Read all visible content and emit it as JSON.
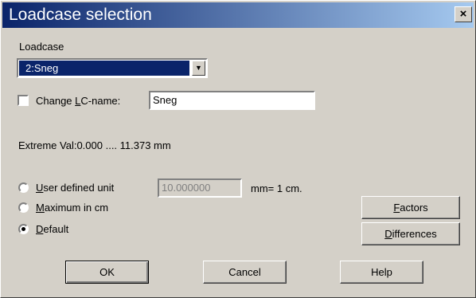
{
  "window": {
    "title": "Loadcase selection",
    "close_label": "×"
  },
  "loadcase": {
    "group_label": "Loadcase",
    "selected": "2:Sneg",
    "dropdown_arrow": "▼"
  },
  "change_name": {
    "label_pre": "Change ",
    "label_access": "L",
    "label_post": "C-name:",
    "value": "Sneg",
    "checked": false
  },
  "extreme_text": "Extreme Val:0.000 .... 11.373  mm",
  "scale": {
    "user_defined": {
      "access": "U",
      "rest": "ser defined unit",
      "value": "10.000000",
      "unit_text": "mm= 1 cm.",
      "selected": false
    },
    "maximum": {
      "access": "M",
      "rest": "aximum in cm",
      "selected": false
    },
    "default": {
      "access": "D",
      "rest": "efault",
      "selected": true
    }
  },
  "buttons": {
    "factors": {
      "access": "F",
      "rest": "actors"
    },
    "differences": {
      "access": "D",
      "rest": "ifferences"
    },
    "ok": "OK",
    "cancel": "Cancel",
    "help": "Help"
  }
}
